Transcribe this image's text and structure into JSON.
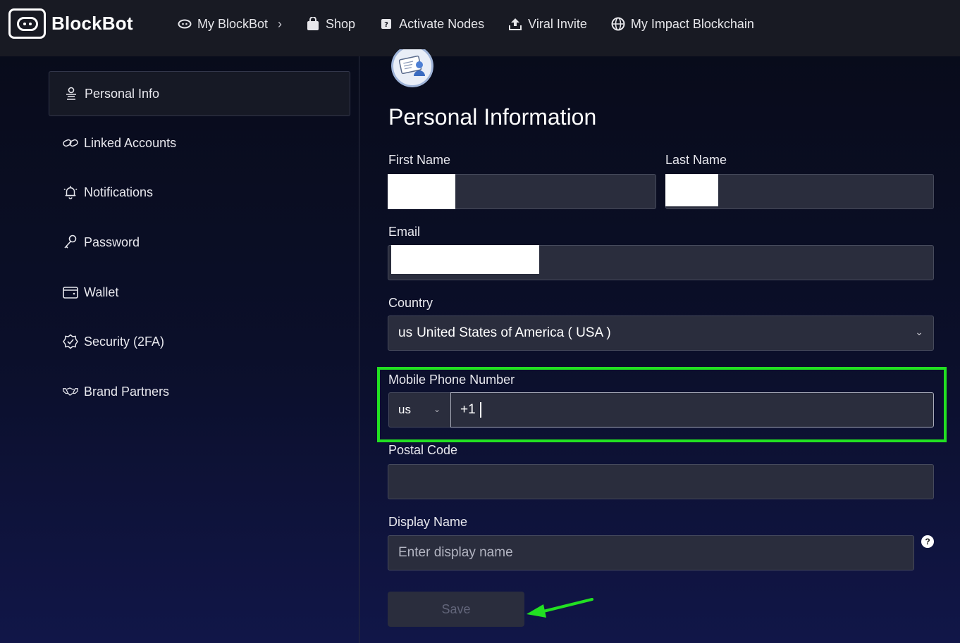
{
  "brand": {
    "name": "BlockBot"
  },
  "nav": [
    {
      "label": "My BlockBot",
      "icon": "eye-icon",
      "has_chevron": true
    },
    {
      "label": "Shop",
      "icon": "shopping-bag-icon"
    },
    {
      "label": "Activate Nodes",
      "icon": "node-icon"
    },
    {
      "label": "Viral Invite",
      "icon": "upload-icon"
    },
    {
      "label": "My Impact Blockchain",
      "icon": "globe-icon"
    }
  ],
  "sidebar": {
    "items": [
      {
        "label": "Personal Info",
        "icon": "person-icon",
        "active": true
      },
      {
        "label": "Linked Accounts",
        "icon": "link-icon"
      },
      {
        "label": "Notifications",
        "icon": "bell-icon"
      },
      {
        "label": "Password",
        "icon": "key-icon"
      },
      {
        "label": "Wallet",
        "icon": "wallet-icon"
      },
      {
        "label": "Security (2FA)",
        "icon": "shield-check-icon"
      },
      {
        "label": "Brand Partners",
        "icon": "handshake-icon"
      }
    ]
  },
  "main": {
    "title": "Personal Information",
    "first_name": {
      "label": "First Name",
      "value": ""
    },
    "last_name": {
      "label": "Last Name",
      "value": ""
    },
    "email": {
      "label": "Email",
      "value": ""
    },
    "country": {
      "label": "Country",
      "code": "us",
      "value": "United States of America ( USA )"
    },
    "phone": {
      "label": "Mobile Phone Number",
      "country_code": "us",
      "value": "+1"
    },
    "postal_code": {
      "label": "Postal Code",
      "value": ""
    },
    "display_name": {
      "label": "Display Name",
      "placeholder": "Enter display name",
      "help": "?"
    },
    "save_label": "Save"
  },
  "colors": {
    "highlight": "#22e022",
    "topbar": "#181a23",
    "field_bg": "#2a2d3d"
  }
}
